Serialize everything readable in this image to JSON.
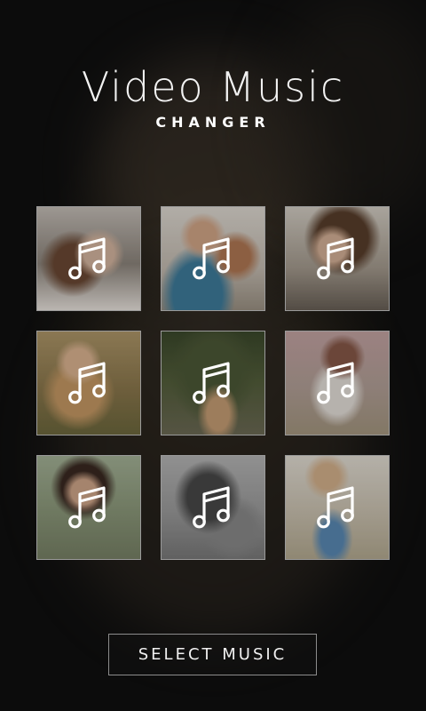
{
  "header": {
    "title": "Video Music",
    "subtitle": "CHANGER"
  },
  "tiles": [
    {
      "icon": "music-note-icon",
      "label": "music-slot-1"
    },
    {
      "icon": "music-note-icon",
      "label": "music-slot-2"
    },
    {
      "icon": "music-note-icon",
      "label": "music-slot-3"
    },
    {
      "icon": "music-note-icon",
      "label": "music-slot-4"
    },
    {
      "icon": "music-note-icon",
      "label": "music-slot-5"
    },
    {
      "icon": "music-note-icon",
      "label": "music-slot-6"
    },
    {
      "icon": "music-note-icon",
      "label": "music-slot-7"
    },
    {
      "icon": "music-note-icon",
      "label": "music-slot-8"
    },
    {
      "icon": "music-note-icon",
      "label": "music-slot-9"
    }
  ],
  "actions": {
    "select_music_label": "SELECT MUSIC"
  },
  "colors": {
    "background": "#0b0b0b",
    "text": "#f2f2f2",
    "tile_border": "#9a9a9a",
    "button_border": "#8c8c8c"
  }
}
